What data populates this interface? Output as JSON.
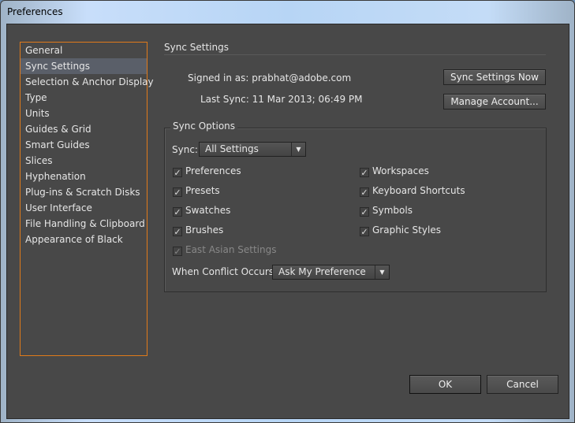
{
  "window": {
    "title": "Preferences"
  },
  "sidebar": {
    "items": [
      "General",
      "Sync Settings",
      "Selection & Anchor Display",
      "Type",
      "Units",
      "Guides & Grid",
      "Smart Guides",
      "Slices",
      "Hyphenation",
      "Plug-ins & Scratch Disks",
      "User Interface",
      "File Handling & Clipboard",
      "Appearance of Black"
    ],
    "selected": "Sync Settings"
  },
  "section": {
    "title": "Sync Settings",
    "signed_in": "Signed in as: prabhat@adobe.com",
    "last_sync": "Last Sync: 11 Mar 2013; 06:49 PM",
    "sync_now": "Sync Settings Now",
    "manage": "Manage Account..."
  },
  "options": {
    "title": "Sync Options",
    "sync_label": "Sync:",
    "sync_value": "All Settings",
    "checkboxes": [
      {
        "label": "Preferences",
        "checked": true
      },
      {
        "label": "Presets",
        "checked": true
      },
      {
        "label": "Swatches",
        "checked": true
      },
      {
        "label": "Brushes",
        "checked": true
      },
      {
        "label": "East Asian Settings",
        "checked": true,
        "disabled": true
      },
      {
        "label": "Workspaces",
        "checked": true
      },
      {
        "label": "Keyboard Shortcuts",
        "checked": true
      },
      {
        "label": "Symbols",
        "checked": true
      },
      {
        "label": "Graphic Styles",
        "checked": true
      }
    ],
    "conflict_label": "When Conflict Occurs:",
    "conflict_value": "Ask My Preference"
  },
  "footer": {
    "ok": "OK",
    "cancel": "Cancel"
  }
}
